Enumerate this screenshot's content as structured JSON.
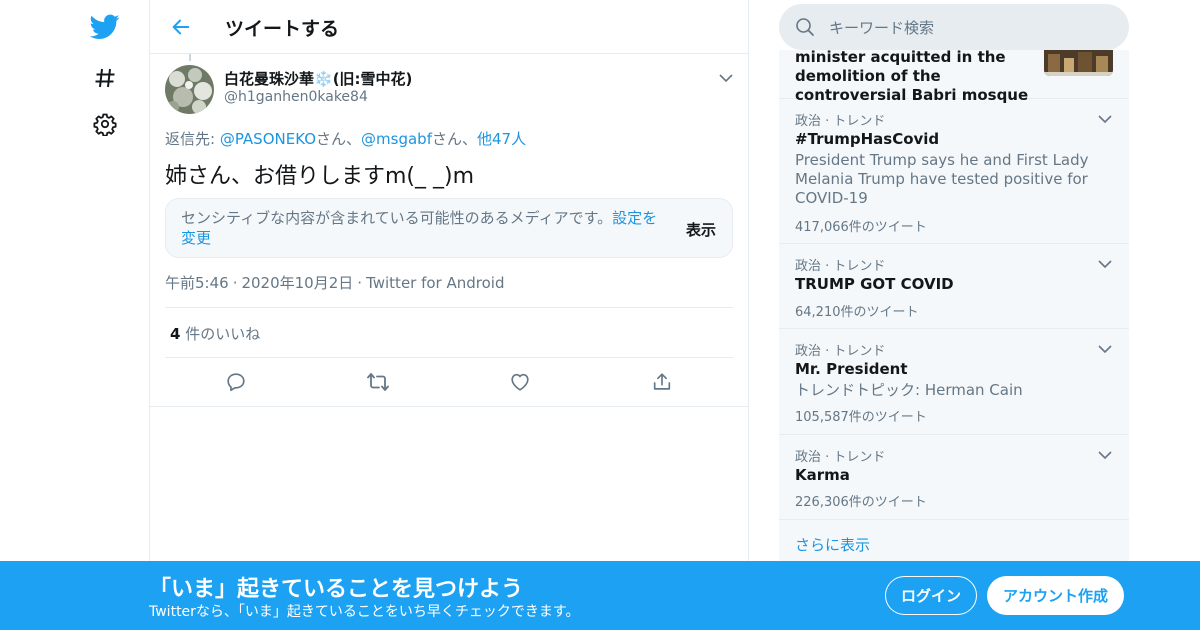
{
  "header": {
    "title": "ツイートする"
  },
  "tweet": {
    "display_name": "白花曼珠沙華",
    "name_emoji": "❄️",
    "name_suffix": "(旧:雪中花)",
    "handle": "@h1ganhen0kake84",
    "reply_prefix": "返信先: ",
    "reply_user1": "@PASONEKO",
    "reply_sep1": "さん、",
    "reply_user2": "@msgabf",
    "reply_sep2": "さん、",
    "reply_others": "他47人",
    "text": "姉さん、お借りしますm(_ _)m",
    "sensitive_text": "センシティブな内容が含まれている可能性のあるメディアです。",
    "sensitive_link": "設定を変更",
    "sensitive_show": "表示",
    "time": "午前5:46",
    "date": "2020年10月2日",
    "separator": "·",
    "source": "Twitter for Android",
    "likes_count": "4",
    "likes_label": " 件のいいね"
  },
  "search": {
    "placeholder": "キーワード検索"
  },
  "news": {
    "text": "minister acquitted in the demolition of the controversial Babri mosque"
  },
  "trends": [
    {
      "category": "政治 · トレンド",
      "name": "#TrumpHasCovid",
      "description": "President Trump says he and First Lady Melania Trump have tested positive for COVID-19",
      "count": "417,066件のツイート"
    },
    {
      "category": "政治 · トレンド",
      "name": "TRUMP GOT COVID",
      "description": "",
      "count": "64,210件のツイート"
    },
    {
      "category": "政治 · トレンド",
      "name": "Mr. President",
      "description": "トレンドトピック: Herman Cain",
      "count": "105,587件のツイート"
    },
    {
      "category": "政治 · トレンド",
      "name": "Karma",
      "description": "",
      "count": "226,306件のツイート"
    }
  ],
  "show_more": "さらに表示",
  "banner": {
    "title": "「いま」起きていることを見つけよう",
    "subtitle": "Twitterなら、「いま」起きていることをいち早くチェックできます。",
    "login": "ログイン",
    "signup": "アカウント作成"
  },
  "colors": {
    "accent": "#1da1f2",
    "link": "#1b95e0",
    "muted": "#657786",
    "border": "#e6ecf0"
  },
  "icons": {
    "nav": [
      "twitter-bird-icon",
      "hashtag-icon",
      "gear-icon"
    ],
    "actions": [
      "reply-icon",
      "retweet-icon",
      "like-icon",
      "share-icon"
    ]
  }
}
